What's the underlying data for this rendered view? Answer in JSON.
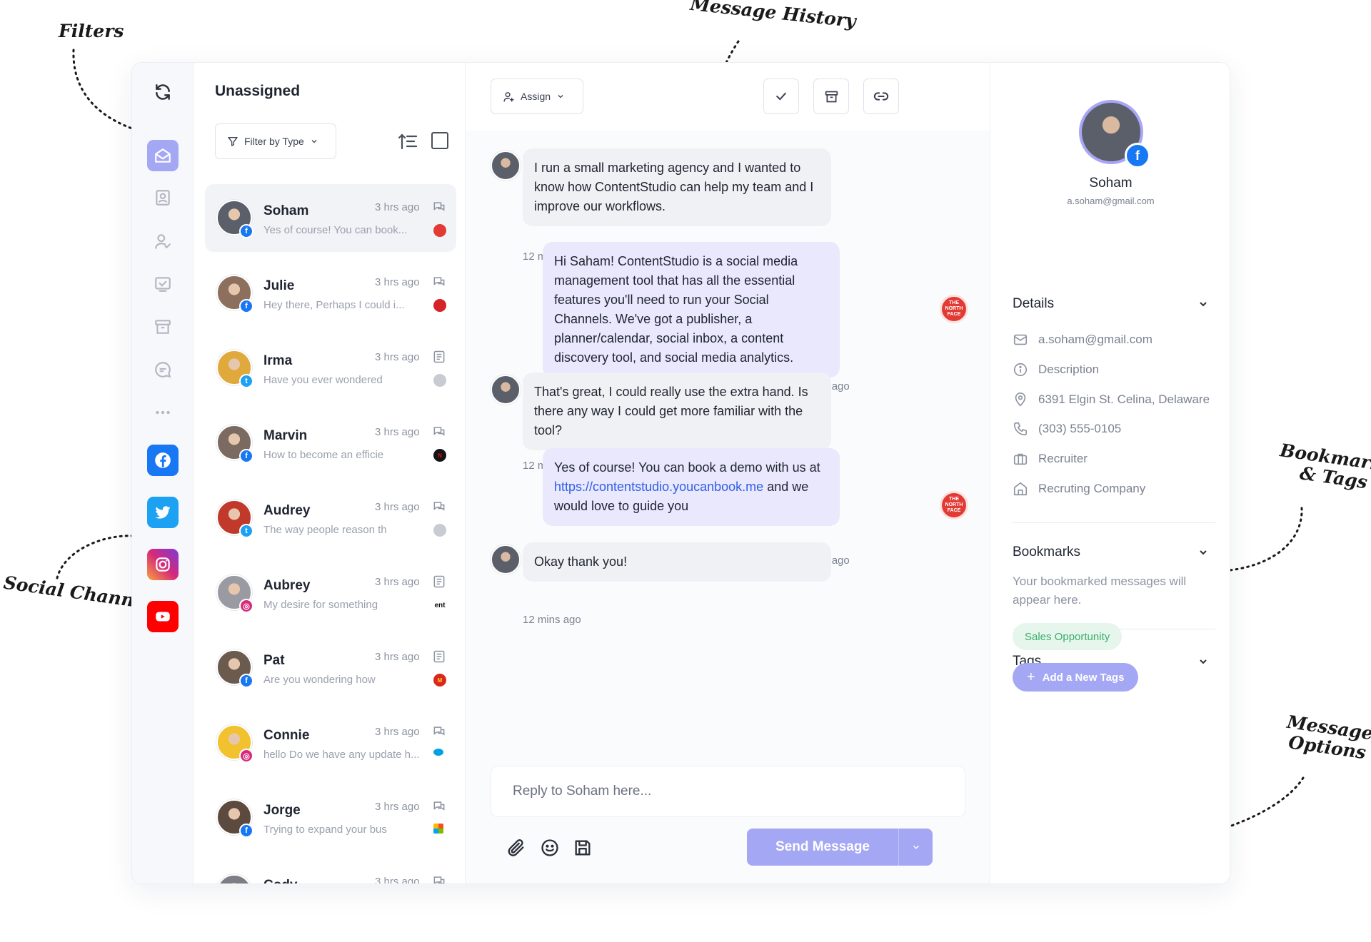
{
  "annotations": {
    "filters": "Filters",
    "message_history": "Message History",
    "social_channels": "Social Channels",
    "bookmarks_tags": [
      "Bookmarks",
      "& Tags"
    ],
    "message_options": [
      "Message",
      "Options"
    ]
  },
  "sidebar": {
    "icons": [
      "refresh-icon",
      "inbox-icon",
      "contacts-icon",
      "assigned-user-icon",
      "done-icon",
      "archive-icon",
      "chat-icon",
      "more-icon"
    ],
    "channels": [
      {
        "name": "facebook-icon",
        "color": "#1877f2"
      },
      {
        "name": "twitter-icon",
        "color": "#1da1f2"
      },
      {
        "name": "instagram-icon",
        "color": "#d6297b"
      },
      {
        "name": "youtube-icon",
        "color": "#ff0000"
      }
    ]
  },
  "list": {
    "title": "Unassigned",
    "filter_label": "Filter by Type",
    "conversations": [
      {
        "name": "Soham",
        "time": "3 hrs ago",
        "snippet": "Yes of course! You can book...",
        "type": "chat-icon",
        "network": "facebook",
        "brand": "the-north-face",
        "avatar_color": "#5a5f6a",
        "active": true
      },
      {
        "name": "Julie",
        "time": "3 hrs ago",
        "snippet": "Hey there, Perhaps I could i...",
        "type": "chat-icon",
        "network": "facebook",
        "brand": "wendys",
        "avatar_color": "#8c6f5c",
        "active": false
      },
      {
        "name": "Irma",
        "time": "3 hrs ago",
        "snippet": "Have you ever wondered",
        "type": "post-icon",
        "network": "twitter",
        "brand": "amazon",
        "avatar_color": "#e0a93b",
        "active": false
      },
      {
        "name": "Marvin",
        "time": "3 hrs ago",
        "snippet": "How to become an efficie",
        "type": "chat-icon",
        "network": "facebook",
        "brand": "netflix",
        "avatar_color": "#7a6a60",
        "active": false
      },
      {
        "name": "Audrey",
        "time": "3 hrs ago",
        "snippet": "The way people reason th",
        "type": "chat-icon",
        "network": "twitter",
        "brand": "amazon",
        "avatar_color": "#c0392b",
        "active": false
      },
      {
        "name": "Aubrey",
        "time": "3 hrs ago",
        "snippet": "My desire for something",
        "type": "post-icon",
        "network": "instagram",
        "brand": "ent",
        "avatar_color": "#9a9aa2",
        "active": false
      },
      {
        "name": "Pat",
        "time": "3 hrs ago",
        "snippet": "Are you wondering how",
        "type": "post-icon",
        "network": "facebook",
        "brand": "mcdonalds",
        "avatar_color": "#6b5a4e",
        "active": false
      },
      {
        "name": "Connie",
        "time": "3 hrs ago",
        "snippet": "hello Do we have any update h...",
        "type": "chat-icon",
        "network": "instagram",
        "brand": "salesforce",
        "avatar_color": "#f2c12e",
        "active": false
      },
      {
        "name": "Jorge",
        "time": "3 hrs ago",
        "snippet": "Trying to expand your bus",
        "type": "chat-icon",
        "network": "facebook",
        "brand": "microsoft",
        "avatar_color": "#5d4a3e",
        "active": false
      },
      {
        "name": "Cody",
        "time": "3 hrs ago",
        "snippet": "",
        "type": "chat-icon",
        "network": "facebook",
        "brand": "",
        "avatar_color": "#7d7d85",
        "active": false
      }
    ]
  },
  "chat": {
    "assign_label": "Assign",
    "actions": [
      "check-icon",
      "archive-icon",
      "link-icon"
    ],
    "messages": [
      {
        "direction": "in",
        "text": "I run a small marketing agency and I wanted to know how ContentStudio can help my team and I improve our workflows.",
        "time": "12 mins ago"
      },
      {
        "direction": "out",
        "text": "Hi Saham! ContentStudio is a social media management tool that has all the essential features you'll need to run your Social Channels. We've got a publisher, a planner/calendar, social inbox, a content discovery tool, and social media analytics.",
        "time": "12 mins ago"
      },
      {
        "direction": "in",
        "text": "That's great, I could really use the extra hand. Is there any way I could get more familiar with the tool?",
        "time": "12 mins ago"
      },
      {
        "direction": "out",
        "text_before": "Yes of course! You can book a demo with us at ",
        "link": "https://contentstudio.youcanbook.me",
        "text_after": " and we would love to guide you",
        "time": "12 mins ago"
      },
      {
        "direction": "in",
        "text": "Okay thank you!",
        "time": "12 mins ago"
      }
    ],
    "brand_badge": "THE NORTH FACE",
    "reply_placeholder": "Reply to Soham here...",
    "send_label": "Send Message"
  },
  "profile": {
    "name": "Soham",
    "email": "a.soham@gmail.com",
    "details_title": "Details",
    "details": [
      {
        "icon": "mail-icon",
        "text": "a.soham@gmail.com"
      },
      {
        "icon": "info-icon",
        "text": "Description"
      },
      {
        "icon": "location-icon",
        "text": "6391 Elgin St. Celina, Delaware"
      },
      {
        "icon": "phone-icon",
        "text": "(303) 555-0105"
      },
      {
        "icon": "briefcase-icon",
        "text": "Recruiter"
      },
      {
        "icon": "building-icon",
        "text": "Recruting Company"
      }
    ],
    "bookmarks_title": "Bookmarks",
    "bookmarks_empty": "Your bookmarked messages will appear here.",
    "tags_title": "Tags",
    "tags": [
      "Sales Opportunity"
    ],
    "add_tag_label": "Add a New Tags"
  },
  "colors": {
    "accent": "#a4a7f4",
    "link": "#2f5ee8",
    "tag_green": "#3dae6a"
  }
}
